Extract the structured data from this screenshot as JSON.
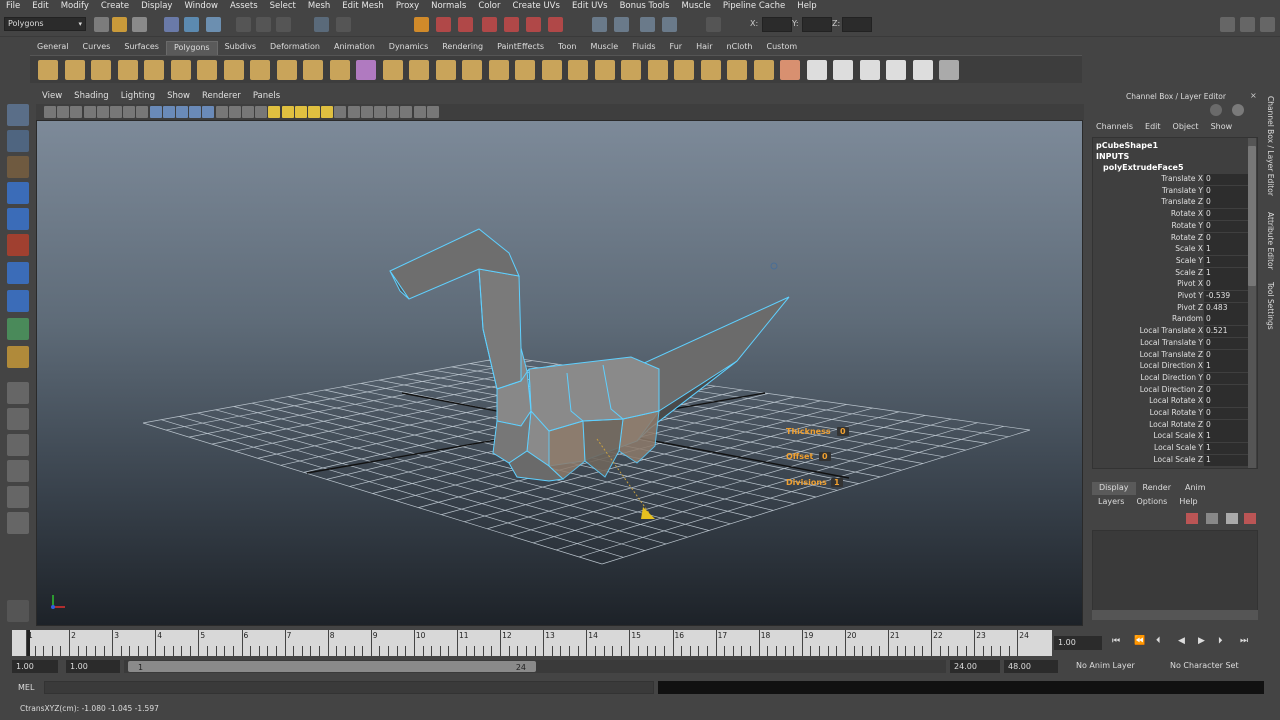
{
  "menubar": [
    "File",
    "Edit",
    "Modify",
    "Create",
    "Display",
    "Window",
    "Assets",
    "Select",
    "Mesh",
    "Edit Mesh",
    "Proxy",
    "Normals",
    "Color",
    "Create UVs",
    "Edit UVs",
    "Bonus Tools",
    "Muscle",
    "Pipeline Cache",
    "Help"
  ],
  "status": {
    "mode": "Polygons",
    "x_label": "X:",
    "y_label": "Y:",
    "z_label": "Z:"
  },
  "shelf_tabs": [
    "General",
    "Curves",
    "Surfaces",
    "Polygons",
    "Subdivs",
    "Deformation",
    "Animation",
    "Dynamics",
    "Rendering",
    "PaintEffects",
    "Toon",
    "Muscle",
    "Fluids",
    "Fur",
    "Hair",
    "nCloth",
    "Custom"
  ],
  "shelf_active": "Polygons",
  "panel_menu": [
    "View",
    "Shading",
    "Lighting",
    "Show",
    "Renderer",
    "Panels"
  ],
  "tweak": {
    "thickness_label": "Thickness",
    "thickness_val": "0",
    "offset_label": "Offset",
    "offset_val": "0",
    "divisions_label": "Divisions",
    "divisions_val": "1"
  },
  "right_panel": {
    "title": "Channel Box / Layer Editor",
    "menu": [
      "Channels",
      "Edit",
      "Object",
      "Show"
    ],
    "shape": "pCubeShape1",
    "inputs": "INPUTS",
    "node": "polyExtrudeFace5",
    "channels": [
      {
        "name": "Translate X",
        "value": "0"
      },
      {
        "name": "Translate Y",
        "value": "0"
      },
      {
        "name": "Translate Z",
        "value": "0"
      },
      {
        "name": "Rotate X",
        "value": "0"
      },
      {
        "name": "Rotate Y",
        "value": "0"
      },
      {
        "name": "Rotate Z",
        "value": "0"
      },
      {
        "name": "Scale X",
        "value": "1"
      },
      {
        "name": "Scale Y",
        "value": "1"
      },
      {
        "name": "Scale Z",
        "value": "1"
      },
      {
        "name": "Pivot X",
        "value": "0"
      },
      {
        "name": "Pivot Y",
        "value": "-0.539"
      },
      {
        "name": "Pivot Z",
        "value": "0.483"
      },
      {
        "name": "Random",
        "value": "0"
      },
      {
        "name": "Local Translate X",
        "value": "0.521"
      },
      {
        "name": "Local Translate Y",
        "value": "0"
      },
      {
        "name": "Local Translate Z",
        "value": "0"
      },
      {
        "name": "Local Direction X",
        "value": "1"
      },
      {
        "name": "Local Direction Y",
        "value": "0"
      },
      {
        "name": "Local Direction Z",
        "value": "0"
      },
      {
        "name": "Local Rotate X",
        "value": "0"
      },
      {
        "name": "Local Rotate Y",
        "value": "0"
      },
      {
        "name": "Local Rotate Z",
        "value": "0"
      },
      {
        "name": "Local Scale X",
        "value": "1"
      },
      {
        "name": "Local Scale Y",
        "value": "1"
      },
      {
        "name": "Local Scale Z",
        "value": "1"
      }
    ],
    "layer_tabs": [
      "Display",
      "Render",
      "Anim"
    ],
    "layer_active": "Display",
    "layer_menu": [
      "Layers",
      "Options",
      "Help"
    ],
    "side_tabs": [
      "Channel Box / Layer Editor",
      "Attribute Editor",
      "Tool Settings"
    ]
  },
  "timeline": {
    "ticks": [
      "1",
      "2",
      "3",
      "4",
      "5",
      "6",
      "7",
      "8",
      "9",
      "10",
      "11",
      "12",
      "13",
      "14",
      "15",
      "16",
      "17",
      "18",
      "19",
      "20",
      "21",
      "22",
      "23",
      "24"
    ],
    "current_time": "1.00"
  },
  "range": {
    "start": "1.00",
    "inner_start": "1.00",
    "thumb_start": "1",
    "thumb_end": "24",
    "end_inner": "24.00",
    "end": "48.00",
    "anim_layer": "No Anim Layer",
    "char_set": "No Character Set"
  },
  "command": {
    "label": "MEL"
  },
  "help_line": "CtransXYZ(cm):   -1.080     -1.045     -1.597",
  "colors": {
    "viewport_top": "#7d8a99",
    "viewport_bottom": "#1d2228",
    "wire": "#5fd0ff",
    "tweak": "#f0a030"
  }
}
